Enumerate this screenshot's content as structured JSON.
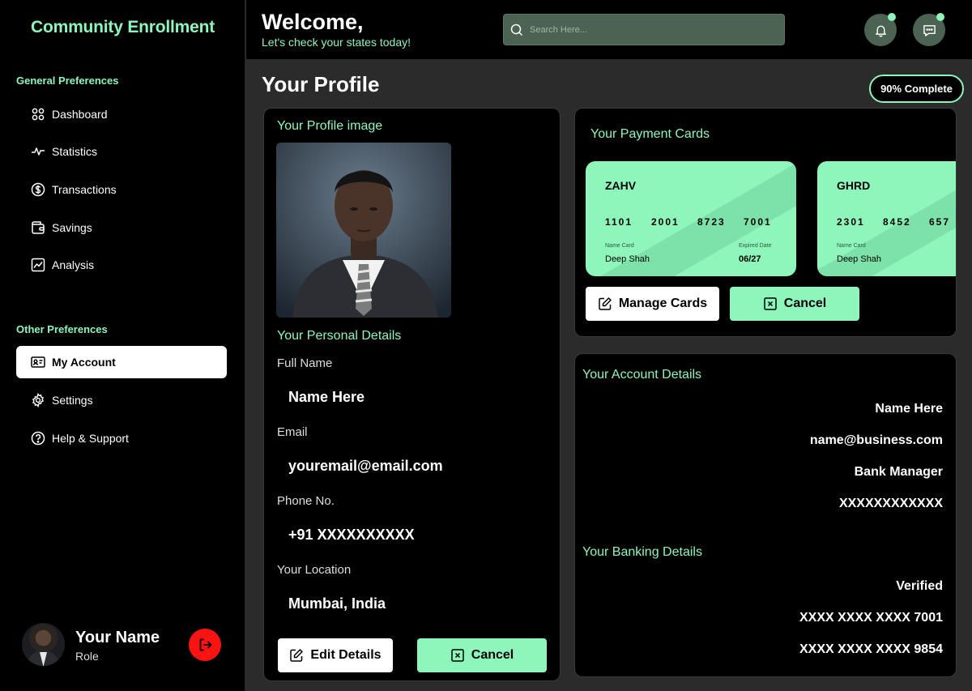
{
  "sidebar": {
    "brand": "Community Enrollment",
    "general_label": "General Preferences",
    "general_items": [
      {
        "label": "Dashboard",
        "icon": "dashboard-icon"
      },
      {
        "label": "Statistics",
        "icon": "pulse-icon"
      },
      {
        "label": "Transactions",
        "icon": "dollar-icon"
      },
      {
        "label": "Savings",
        "icon": "wallet-icon"
      },
      {
        "label": "Analysis",
        "icon": "chart-icon"
      }
    ],
    "other_label": "Other Preferences",
    "other_items": [
      {
        "label": "My Account",
        "icon": "id-card-icon",
        "active": true
      },
      {
        "label": "Settings",
        "icon": "gear-icon"
      },
      {
        "label": "Help & Support",
        "icon": "help-icon"
      }
    ],
    "user": {
      "name": "Your Name",
      "role": "Role"
    }
  },
  "header": {
    "welcome": "Welcome,",
    "subtitle": "Let's check your states today!",
    "search_placeholder": "Search Here..."
  },
  "main": {
    "title": "Your Profile",
    "complete_badge": "90% Complete",
    "profile": {
      "image_title": "Your Profile image",
      "details_title": "Your Personal Details",
      "fields": [
        {
          "label": "Full Name",
          "value": "Name Here"
        },
        {
          "label": "Email",
          "value": "youremail@email.com"
        },
        {
          "label": "Phone No.",
          "value": "+91 XXXXXXXXXX"
        },
        {
          "label": "Your Location",
          "value": "Mumbai, India"
        }
      ],
      "edit_label": "Edit Details",
      "cancel_label": "Cancel"
    },
    "payment": {
      "title": "Your Payment Cards",
      "cards": [
        {
          "bank": "ZAHV",
          "numbers": [
            "1101",
            "2001",
            "8723",
            "7001"
          ],
          "name_label": "Name Card",
          "holder": "Deep Shah",
          "expiry_label": "Expired Date",
          "expiry": "06/27"
        },
        {
          "bank": "GHRD",
          "numbers": [
            "2301",
            "8452",
            "657"
          ],
          "name_label": "Name Card",
          "holder": "Deep Shah"
        }
      ],
      "manage_label": "Manage Cards",
      "cancel_label": "Cancel"
    },
    "account": {
      "title": "Your Account Details",
      "values": [
        "Name Here",
        "name@business.com",
        "Bank Manager",
        "XXXXXXXXXXXX"
      ],
      "banking_title": "Your Banking Details",
      "banking_values": [
        "Verified",
        "XXXX XXXX XXXX 7001",
        "XXXX XXXX XXXX 9854"
      ]
    }
  },
  "colors": {
    "accent": "#8ef5bb",
    "panel": "#000000",
    "main_bg": "#2b2b2b",
    "logout": "#ff1212",
    "search_bg": "#4c6253"
  }
}
